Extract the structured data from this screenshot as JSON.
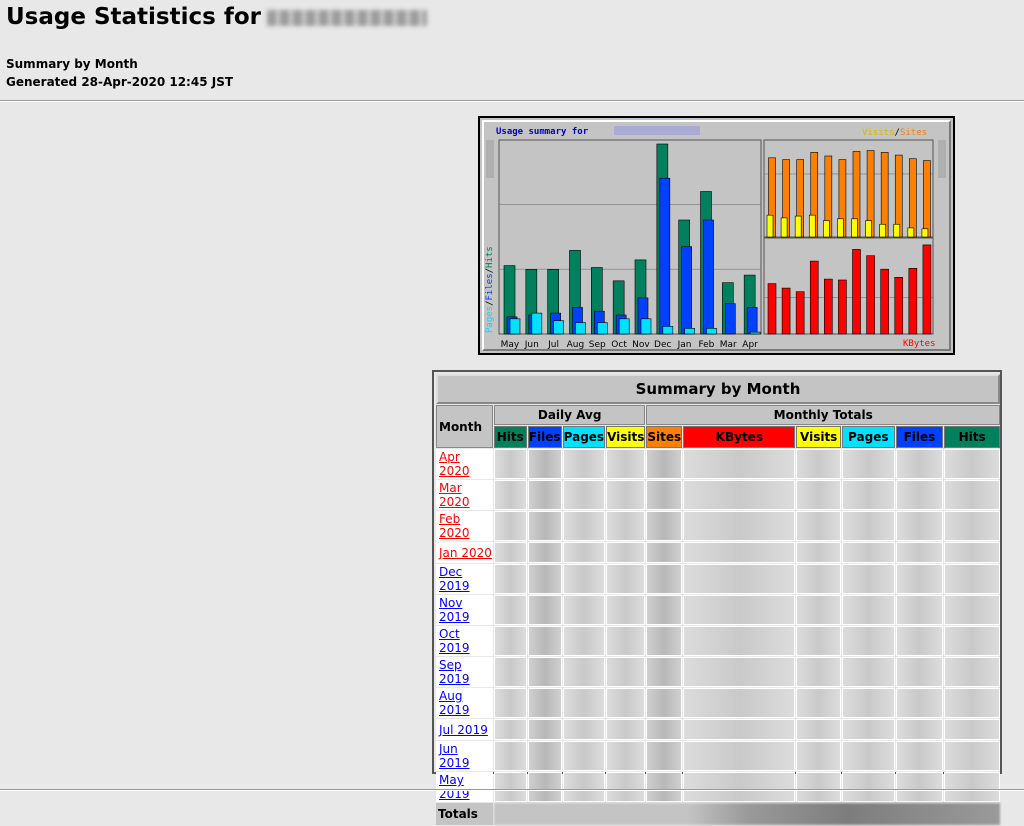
{
  "page": {
    "title_prefix": "Usage Statistics for",
    "subtitle": "Summary by Month",
    "generated": "Generated 28-Apr-2020 12:45 JST"
  },
  "colors": {
    "hits": "#00805c",
    "files": "#0040ff",
    "pages": "#00e0ff",
    "visits": "#ffff00",
    "sites": "#ff8000",
    "kbytes": "#ff0000",
    "link_current_year": "#ff0000",
    "link_prev_year": "#0000ff"
  },
  "chart": {
    "title": "Usage summary for",
    "legend_visits": "Visits",
    "legend_sep": "/",
    "legend_sites": "Sites",
    "left_axis": [
      "Pages",
      "/",
      "Files",
      "/",
      "Hits"
    ],
    "kbytes_label": "KBytes"
  },
  "chart_data": {
    "type": "bar",
    "categories": [
      "May",
      "Jun",
      "Jul",
      "Aug",
      "Sep",
      "Oct",
      "Nov",
      "Dec",
      "Jan",
      "Feb",
      "Mar",
      "Apr"
    ],
    "series": [
      {
        "name": "Hits",
        "values": [
          36,
          34,
          34,
          44,
          35,
          28,
          39,
          100,
          60,
          75,
          27,
          31
        ]
      },
      {
        "name": "Files",
        "values": [
          9,
          10,
          11,
          14,
          12,
          10,
          19,
          82,
          46,
          60,
          16,
          14
        ]
      },
      {
        "name": "Pages",
        "values": [
          8,
          11,
          7,
          6,
          6,
          8,
          8,
          4,
          3,
          3,
          0,
          1
        ]
      },
      {
        "name": "Visits",
        "values": [
          24,
          21,
          23,
          24,
          18,
          20,
          20,
          18,
          14,
          14,
          10,
          9
        ]
      },
      {
        "name": "Sites",
        "values": [
          87,
          85,
          85,
          93,
          89,
          85,
          94,
          95,
          93,
          90,
          86,
          84
        ]
      },
      {
        "name": "KBytes",
        "values": [
          56,
          51,
          47,
          81,
          61,
          60,
          94,
          87,
          72,
          63,
          73,
          99
        ]
      }
    ]
  },
  "table": {
    "title": "Summary by Month",
    "month_header": "Month",
    "daily_avg": "Daily Avg",
    "monthly_totals": "Monthly Totals",
    "daily_cols": [
      "Hits",
      "Files",
      "Pages",
      "Visits"
    ],
    "monthly_cols": [
      "Sites",
      "KBytes",
      "Visits",
      "Pages",
      "Files",
      "Hits"
    ],
    "months": [
      "Apr 2020",
      "Mar 2020",
      "Feb 2020",
      "Jan 2020",
      "Dec 2019",
      "Nov 2019",
      "Oct 2019",
      "Sep 2019",
      "Aug 2019",
      "Jul 2019",
      "Jun 2019",
      "May 2019"
    ],
    "totals_label": "Totals"
  }
}
